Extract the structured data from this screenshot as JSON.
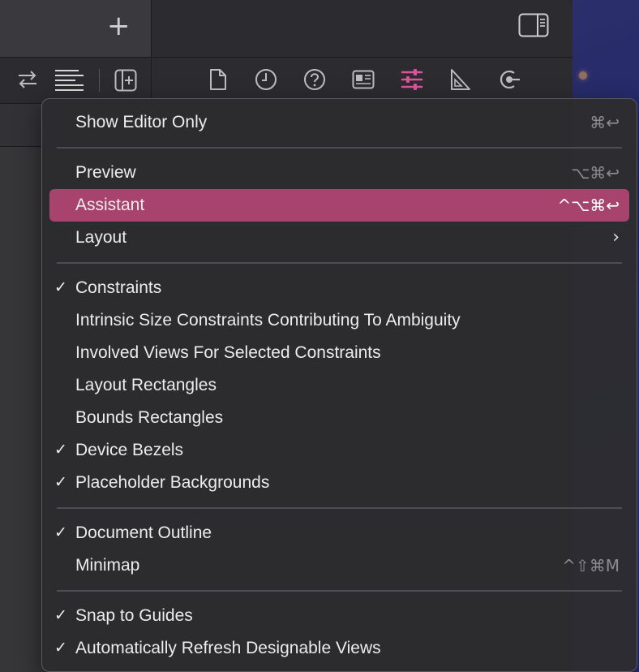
{
  "colors": {
    "accent": "#a8436e",
    "accent_icon": "#e0529a"
  },
  "tabbar": {
    "add_tab_label": "+"
  },
  "toolbar": {
    "icons": [
      "swap-arrows-icon",
      "text-align-icon",
      "add-editor-icon",
      "file-icon",
      "history-icon",
      "help-icon",
      "inspector-icon",
      "attributes-icon",
      "ruler-icon",
      "connections-icon"
    ]
  },
  "menu": {
    "items": [
      {
        "label": "Show Editor Only",
        "shortcut": "⌘↩",
        "checked": ""
      },
      {
        "label": "Preview",
        "shortcut": "⌥⌘↩",
        "checked": ""
      },
      {
        "label": "Assistant",
        "shortcut": "^⌥⌘↩",
        "checked": ""
      },
      {
        "label": "Layout",
        "submenu": "›",
        "checked": ""
      },
      {
        "label": "Constraints",
        "checked": "✓"
      },
      {
        "label": "Intrinsic Size Constraints Contributing To Ambiguity",
        "checked": ""
      },
      {
        "label": "Involved Views For Selected Constraints",
        "checked": ""
      },
      {
        "label": "Layout Rectangles",
        "checked": ""
      },
      {
        "label": "Bounds Rectangles",
        "checked": ""
      },
      {
        "label": "Device Bezels",
        "checked": "✓"
      },
      {
        "label": "Placeholder Backgrounds",
        "checked": "✓"
      },
      {
        "label": "Document Outline",
        "checked": "✓"
      },
      {
        "label": "Minimap",
        "shortcut": "^⇧⌘M",
        "checked": ""
      },
      {
        "label": "Snap to Guides",
        "checked": "✓"
      },
      {
        "label": "Automatically Refresh Designable Views",
        "checked": "✓"
      }
    ]
  }
}
